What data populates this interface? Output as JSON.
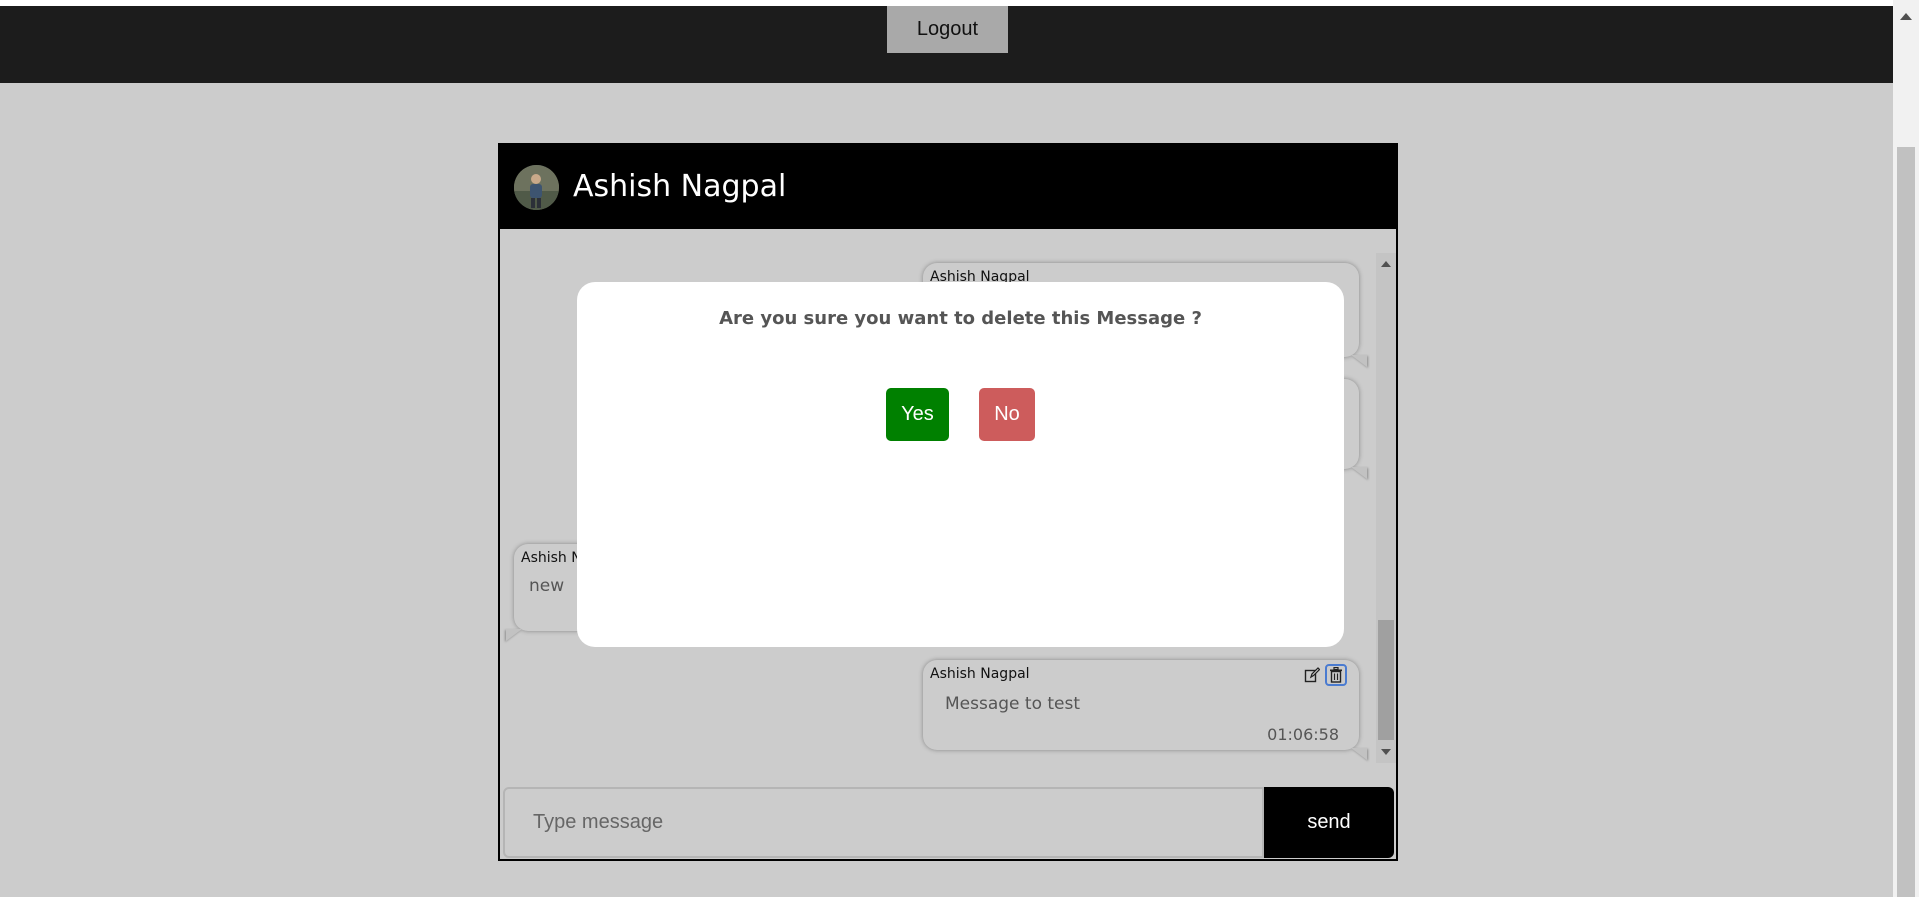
{
  "navbar": {
    "logout_label": "Logout"
  },
  "chat": {
    "contact_name": "Ashish Nagpal",
    "messages": [
      {
        "author": "Ashish Nagpal",
        "text": "",
        "time": "",
        "side": "right"
      },
      {
        "author": "",
        "text": "",
        "time": "",
        "side": "right"
      },
      {
        "author": "Ashish N",
        "text": "new",
        "time": "",
        "side": "left"
      },
      {
        "author": "Ashish Nagpal",
        "text": "Message to test",
        "time": "01:06:58",
        "side": "right"
      }
    ],
    "input_placeholder": "Type message",
    "send_label": "send"
  },
  "modal": {
    "title": "Are you sure you want to delete this Message ?",
    "yes_label": "Yes",
    "no_label": "No"
  },
  "icons": {
    "edit": "edit-icon",
    "delete": "trash-icon",
    "avatar": "avatar-photo"
  },
  "colors": {
    "navbar_bg": "#1c1c1c",
    "page_bg": "#cccccc",
    "header_bg": "#000000",
    "yes_button": "#008000",
    "no_button": "#cd5c5c",
    "send_button": "#000000"
  }
}
